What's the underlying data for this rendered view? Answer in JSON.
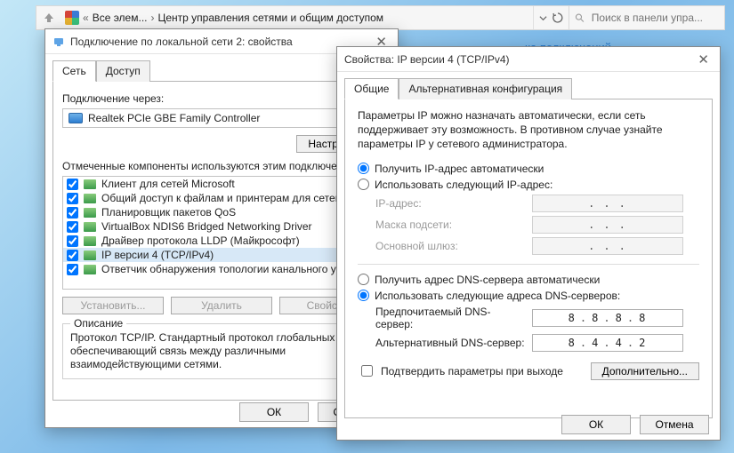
{
  "explorer": {
    "crumb1": "Все элем...",
    "crumb2": "Центр управления сетями и общим доступом",
    "search_placeholder": "Поиск в панели упра..."
  },
  "bg_link": "ка полключений",
  "dlg1": {
    "title": "Подключение по локальной сети 2: свойства",
    "tabs": {
      "net": "Сеть",
      "access": "Доступ"
    },
    "conn_label": "Подключение через:",
    "adapter": "Realtek PCIe GBE Family Controller",
    "configure": "Настроить...",
    "comp_label": "Отмеченные компоненты используются этим подключен…",
    "components": [
      "Клиент для сетей Microsoft",
      "Общий доступ к файлам и принтерам для сетей…",
      "Планировщик пакетов QoS",
      "VirtualBox NDIS6 Bridged Networking Driver",
      "Драйвер протокола LLDP (Майкрософт)",
      "IP версии 4 (TCP/IPv4)",
      "Ответчик обнаружения топологии канального ур…"
    ],
    "selected_index": 5,
    "install": "Установить...",
    "remove": "Удалить",
    "props": "Свойства",
    "desc_legend": "Описание",
    "desc": "Протокол TCP/IP. Стандартный протокол глобальных сетей, обеспечивающий связь между различными взаимодействующими сетями.",
    "ok": "ОК",
    "cancel": "Отмена"
  },
  "dlg2": {
    "title": "Свойства: IP версии 4 (TCP/IPv4)",
    "tabs": {
      "general": "Общие",
      "alt": "Альтернативная конфигурация"
    },
    "info": "Параметры IP можно назначать автоматически, если сеть поддерживает эту возможность. В противном случае узнайте параметры IP у сетевого администратора.",
    "ip_auto": "Получить IP-адрес автоматически",
    "ip_manual": "Использовать следующий IP-адрес:",
    "ip_addr_label": "IP-адрес:",
    "mask_label": "Маска подсети:",
    "gw_label": "Основной шлюз:",
    "dns_auto": "Получить адрес DNS-сервера автоматически",
    "dns_manual": "Использовать следующие адреса DNS-серверов:",
    "dns_pref_label": "Предпочитаемый DNS-сервер:",
    "dns_alt_label": "Альтернативный DNS-сервер:",
    "dns_pref_val": [
      "8",
      "8",
      "8",
      "8"
    ],
    "dns_alt_val": [
      "8",
      "4",
      "4",
      "2"
    ],
    "validate": "Подтвердить параметры при выходе",
    "advanced": "Дополнительно...",
    "ok": "ОК",
    "cancel": "Отмена"
  }
}
